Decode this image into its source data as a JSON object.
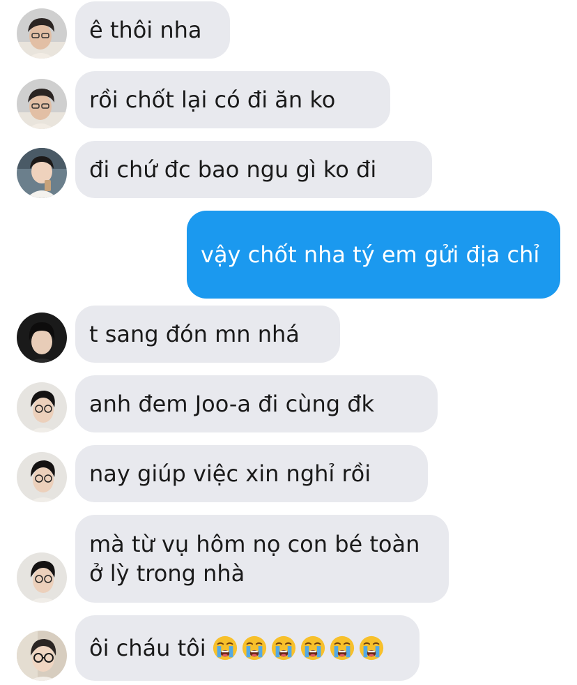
{
  "chat": {
    "colors": {
      "incoming_bubble": "#e8e9ee",
      "outgoing_bubble": "#1b99ef",
      "outgoing_text": "#ffffff",
      "incoming_text": "#1a1a1a"
    },
    "messages": [
      {
        "sender": "incoming",
        "avatar": "avatar-glasses-boy",
        "text": "ê thôi nha"
      },
      {
        "sender": "incoming",
        "avatar": "avatar-glasses-boy",
        "text": "rồi chốt lại có đi ăn ko"
      },
      {
        "sender": "incoming",
        "avatar": "avatar-boy-drink",
        "text": "đi chứ đc bao ngu gì ko đi"
      },
      {
        "sender": "outgoing",
        "text": "vậy chốt nha tý em gửi địa chỉ"
      },
      {
        "sender": "incoming",
        "avatar": "avatar-dark-hair-boy",
        "text": "t sang đón mn nhá"
      },
      {
        "sender": "incoming",
        "avatar": "avatar-glasses-man",
        "text": "anh đem Joo-a đi cùng đk"
      },
      {
        "sender": "incoming",
        "avatar": "avatar-glasses-man",
        "text": "nay giúp việc xin nghỉ rồi"
      },
      {
        "sender": "incoming",
        "avatar": "avatar-glasses-man",
        "text": "mà từ vụ hôm nọ con bé toàn ở lỳ trong nhà"
      },
      {
        "sender": "incoming",
        "avatar": "avatar-round-glasses-boy",
        "text": "ôi cháu tôi",
        "emoji": "loudly-crying-face",
        "emoji_count": 6
      }
    ]
  }
}
